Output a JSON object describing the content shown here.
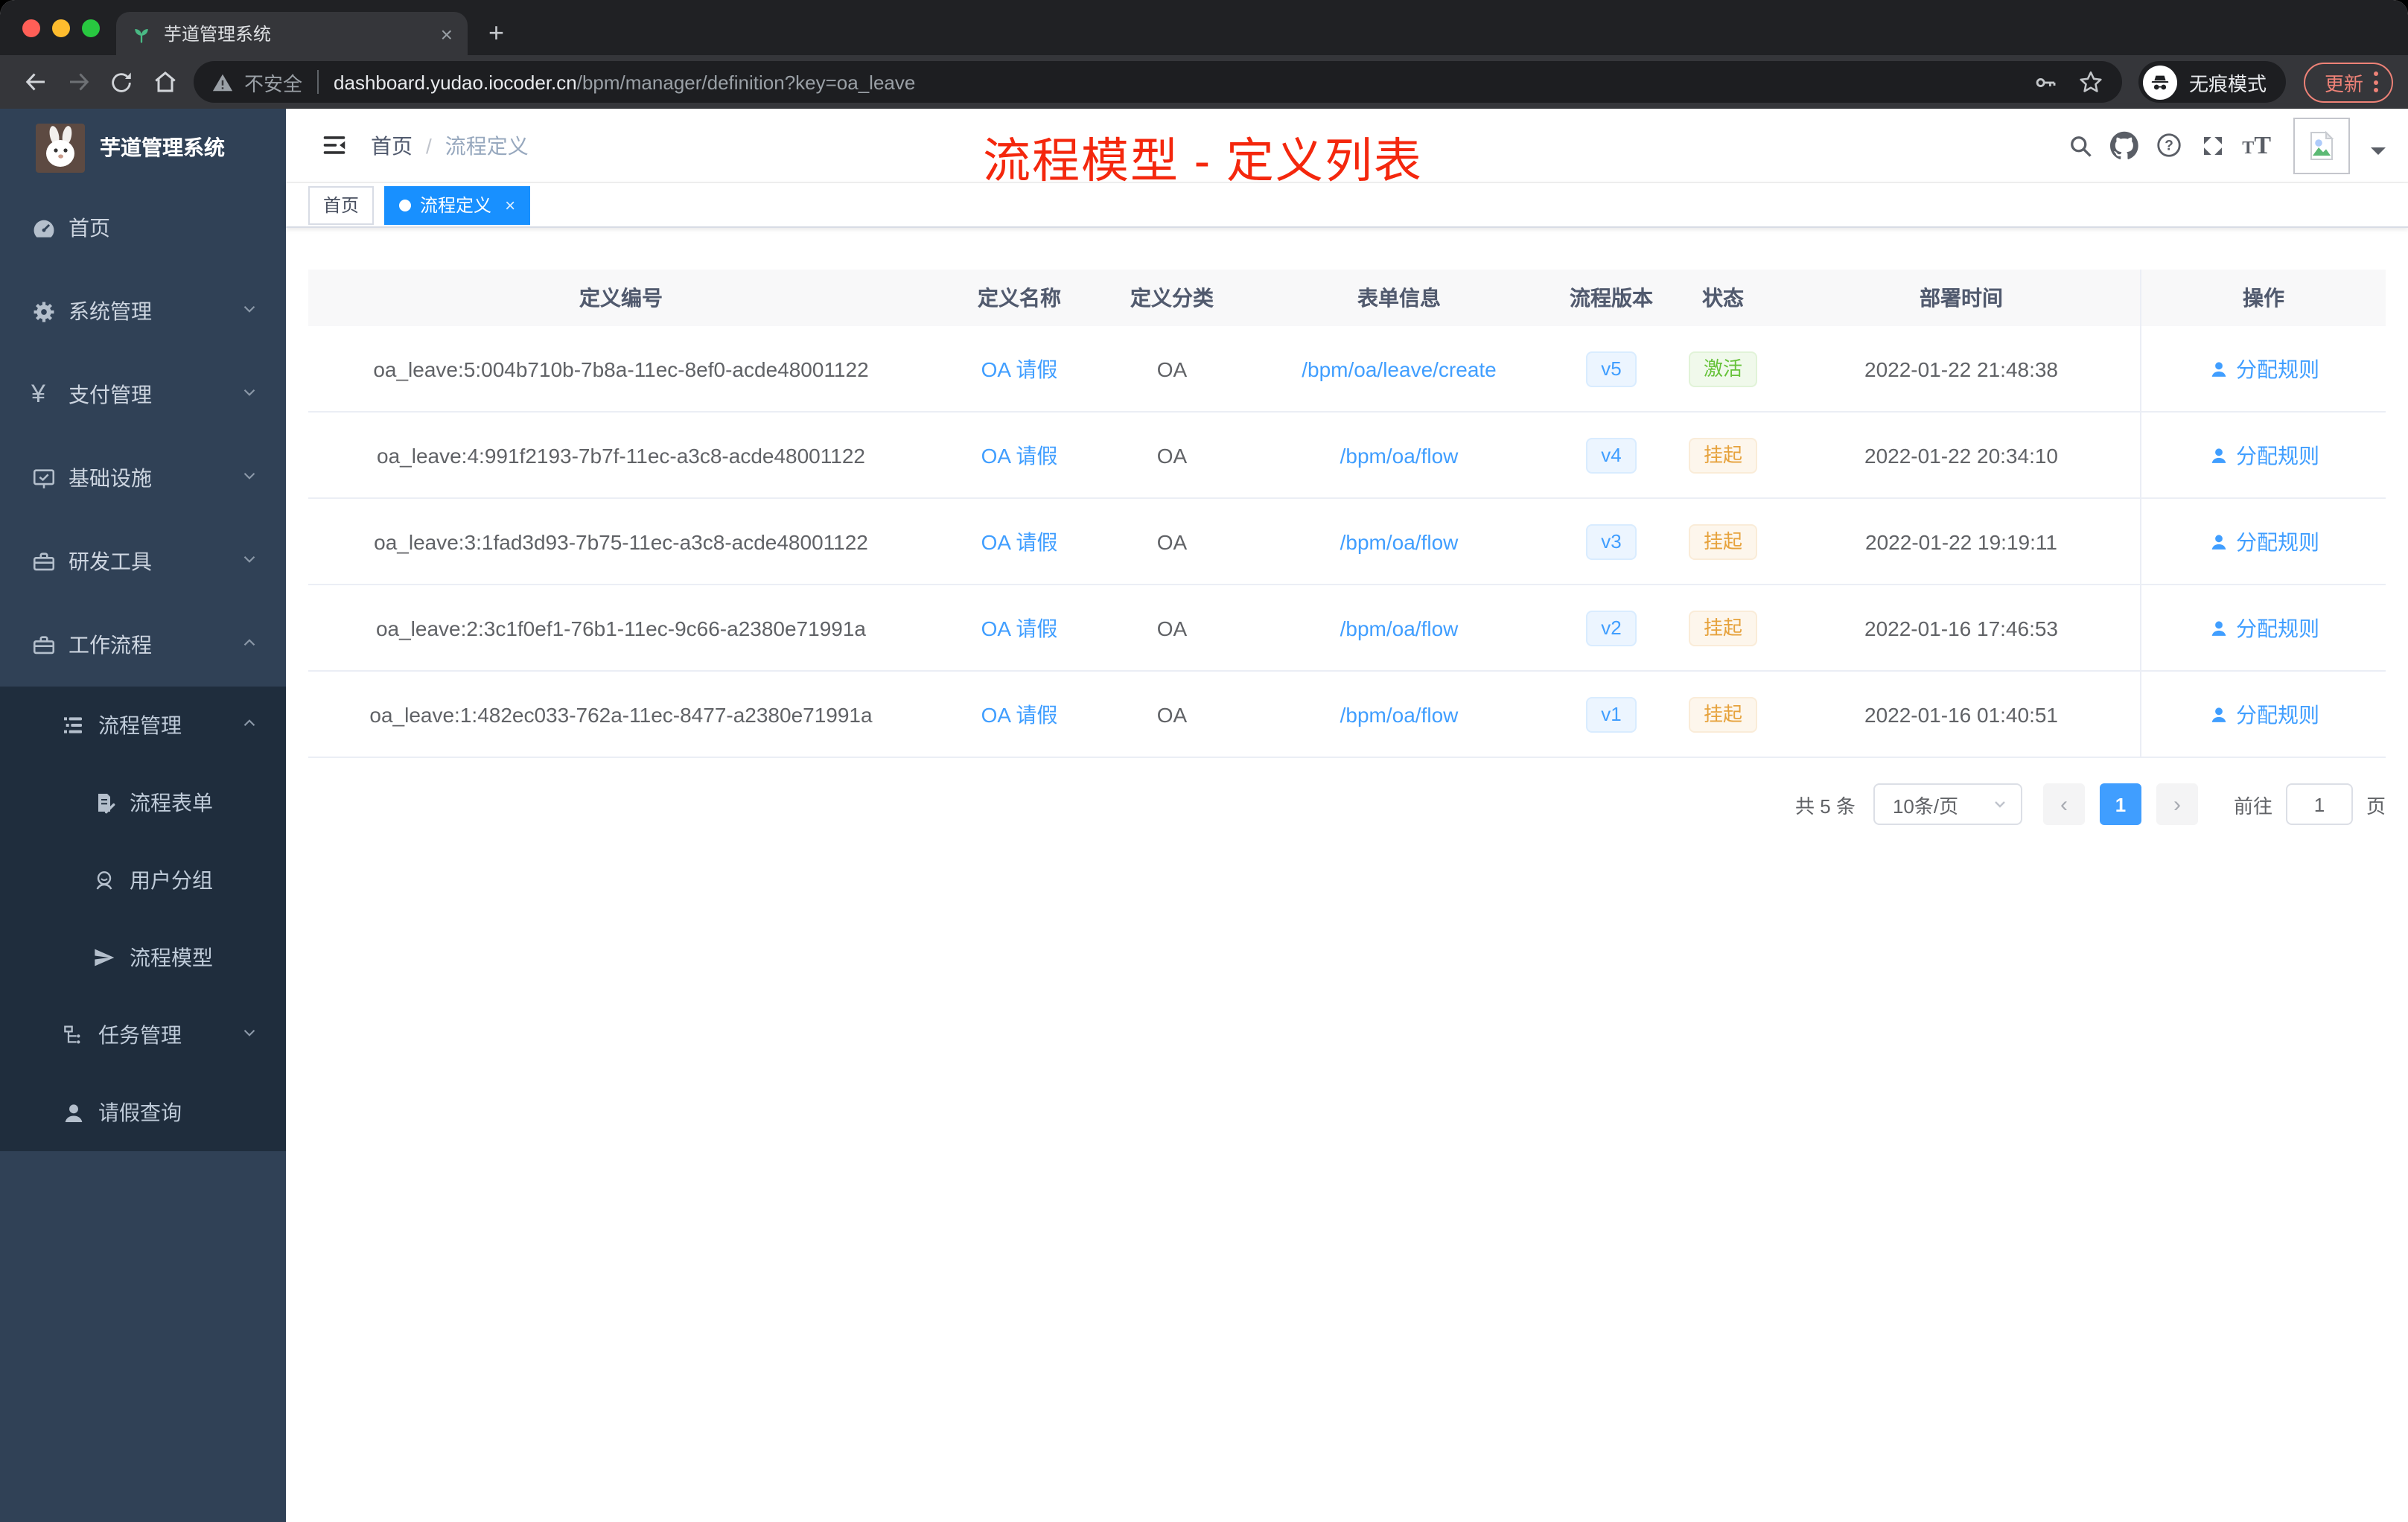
{
  "browser": {
    "tab_title": "芋道管理系统",
    "security_label": "不安全",
    "url_host": "dashboard.yudao.iocoder.cn",
    "url_path": "/bpm/manager/definition?key=oa_leave",
    "incognito_label": "无痕模式",
    "update_label": "更新"
  },
  "icons": {
    "close": "×",
    "plus": "+",
    "prev_arrow": "‹",
    "next_arrow": "›"
  },
  "sidebar": {
    "app_title": "芋道管理系统",
    "items": [
      {
        "label": "首页",
        "icon": "dashboard-icon",
        "level": 1
      },
      {
        "label": "系统管理",
        "icon": "gear-icon",
        "level": 1,
        "expanded": false
      },
      {
        "label": "支付管理",
        "icon": "yen-icon",
        "level": 1,
        "expanded": false
      },
      {
        "label": "基础设施",
        "icon": "monitor-icon",
        "level": 1,
        "expanded": false
      },
      {
        "label": "研发工具",
        "icon": "briefcase-icon",
        "level": 1,
        "expanded": false
      },
      {
        "label": "工作流程",
        "icon": "briefcase-icon",
        "level": 1,
        "expanded": true
      },
      {
        "label": "流程管理",
        "icon": "list-icon",
        "level": 2,
        "expanded": true
      },
      {
        "label": "流程表单",
        "icon": "document-edit-icon",
        "level": 3
      },
      {
        "label": "用户分组",
        "icon": "user-group-icon",
        "level": 3
      },
      {
        "label": "流程模型",
        "icon": "paper-plane-icon",
        "level": 3
      },
      {
        "label": "任务管理",
        "icon": "tree-icon",
        "level": 2,
        "expanded": false
      },
      {
        "label": "请假查询",
        "icon": "person-icon",
        "level": 2
      }
    ]
  },
  "header": {
    "breadcrumb": [
      "首页",
      "流程定义"
    ],
    "breadcrumb_separator": "/",
    "annotation": "流程模型 - 定义列表",
    "annotation_color": "#f4270d"
  },
  "tags": [
    {
      "label": "首页",
      "active": false
    },
    {
      "label": "流程定义",
      "active": true
    }
  ],
  "table": {
    "columns": [
      "定义编号",
      "定义名称",
      "定义分类",
      "表单信息",
      "流程版本",
      "状态",
      "部署时间",
      "操作"
    ],
    "rows": [
      {
        "id": "oa_leave:5:004b710b-7b8a-11ec-8ef0-acde48001122",
        "name": "OA 请假",
        "category": "OA",
        "form": "/bpm/oa/leave/create",
        "version": "v5",
        "status": "激活",
        "deploy_time": "2022-01-22 21:48:38",
        "action": "分配规则"
      },
      {
        "id": "oa_leave:4:991f2193-7b7f-11ec-a3c8-acde48001122",
        "name": "OA 请假",
        "category": "OA",
        "form": "/bpm/oa/flow",
        "version": "v4",
        "status": "挂起",
        "deploy_time": "2022-01-22 20:34:10",
        "action": "分配规则"
      },
      {
        "id": "oa_leave:3:1fad3d93-7b75-11ec-a3c8-acde48001122",
        "name": "OA 请假",
        "category": "OA",
        "form": "/bpm/oa/flow",
        "version": "v3",
        "status": "挂起",
        "deploy_time": "2022-01-22 19:19:11",
        "action": "分配规则"
      },
      {
        "id": "oa_leave:2:3c1f0ef1-76b1-11ec-9c66-a2380e71991a",
        "name": "OA 请假",
        "category": "OA",
        "form": "/bpm/oa/flow",
        "version": "v2",
        "status": "挂起",
        "deploy_time": "2022-01-16 17:46:53",
        "action": "分配规则"
      },
      {
        "id": "oa_leave:1:482ec033-762a-11ec-8477-a2380e71991a",
        "name": "OA 请假",
        "category": "OA",
        "form": "/bpm/oa/flow",
        "version": "v1",
        "status": "挂起",
        "deploy_time": "2022-01-16 01:40:51",
        "action": "分配规则"
      }
    ]
  },
  "pagination": {
    "total_label": "共 5 条",
    "page_size": "10条/页",
    "current_page": "1",
    "goto_label": "前往",
    "goto_value": "1",
    "page_unit": "页"
  },
  "colors": {
    "link_blue": "#409eff",
    "tag_active_blue": "#1890ff",
    "status_active_green": "#67c23a",
    "status_suspended_orange": "#e6a23c",
    "sidebar_bg": "#304156",
    "submenu_bg": "#1f2d3d",
    "annotation_red": "#f4270d",
    "update_pill_salmon": "#ee8277"
  }
}
